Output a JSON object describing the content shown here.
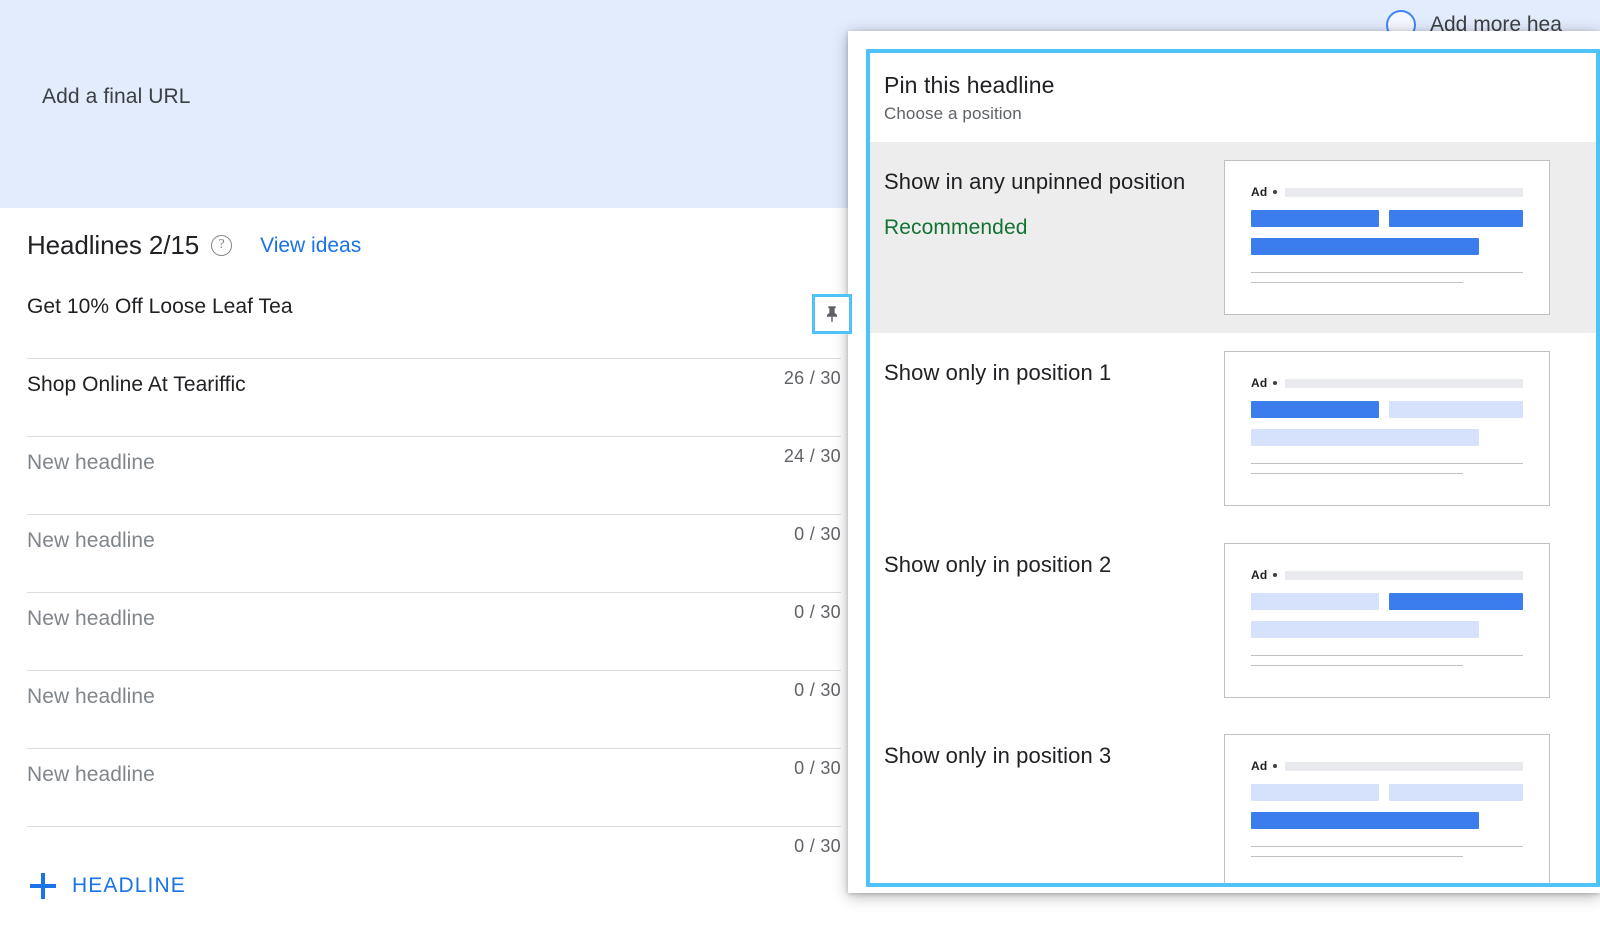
{
  "top_panel": {
    "final_url_label": "Add a final URL",
    "add_more_label": "Add more hea",
    "progress_icon": "circle-progress-icon",
    "background_color": "#e3ecfd"
  },
  "headlines_card": {
    "title": "Headlines 2/15",
    "help_icon": "help-circle-icon",
    "help_glyph": "?",
    "view_ideas_label": "View ideas",
    "add_button_label": "HEADLINE",
    "add_button_icon": "plus-icon",
    "pin_icon": "pin-icon",
    "accent_color": "#1a73e8",
    "rows": [
      {
        "text": "Get 10% Off Loose Leaf Tea",
        "is_placeholder": false,
        "counter": "26 / 30",
        "pinned": true
      },
      {
        "text": "Shop Online At Teariffic",
        "is_placeholder": false,
        "counter": "24 / 30",
        "pinned": false
      },
      {
        "text": "New headline",
        "is_placeholder": true,
        "counter": "0 / 30",
        "pinned": false
      },
      {
        "text": "New headline",
        "is_placeholder": true,
        "counter": "0 / 30",
        "pinned": false
      },
      {
        "text": "New headline",
        "is_placeholder": true,
        "counter": "0 / 30",
        "pinned": false
      },
      {
        "text": "New headline",
        "is_placeholder": true,
        "counter": "0 / 30",
        "pinned": false
      },
      {
        "text": "New headline",
        "is_placeholder": true,
        "counter": "0 / 30",
        "pinned": false
      }
    ]
  },
  "pin_dialog": {
    "title": "Pin this headline",
    "subtitle": "Choose a position",
    "highlight_color": "#4fc3f7",
    "recommended_color": "#137333",
    "options": [
      {
        "label": "Show in any unpinned position",
        "recommended_label": "Recommended",
        "hovered": true,
        "preview": {
          "ad_tag": "Ad",
          "bar1": "on",
          "bar2": "on",
          "bar3": "on"
        }
      },
      {
        "label": "Show only in position 1",
        "recommended_label": "",
        "hovered": false,
        "preview": {
          "ad_tag": "Ad",
          "bar1": "on",
          "bar2": "off",
          "bar3": "off"
        }
      },
      {
        "label": "Show only in position 2",
        "recommended_label": "",
        "hovered": false,
        "preview": {
          "ad_tag": "Ad",
          "bar1": "off",
          "bar2": "on",
          "bar3": "off"
        }
      },
      {
        "label": "Show only in position 3",
        "recommended_label": "",
        "hovered": false,
        "preview": {
          "ad_tag": "Ad",
          "bar1": "off",
          "bar2": "off",
          "bar3": "on"
        }
      }
    ]
  }
}
